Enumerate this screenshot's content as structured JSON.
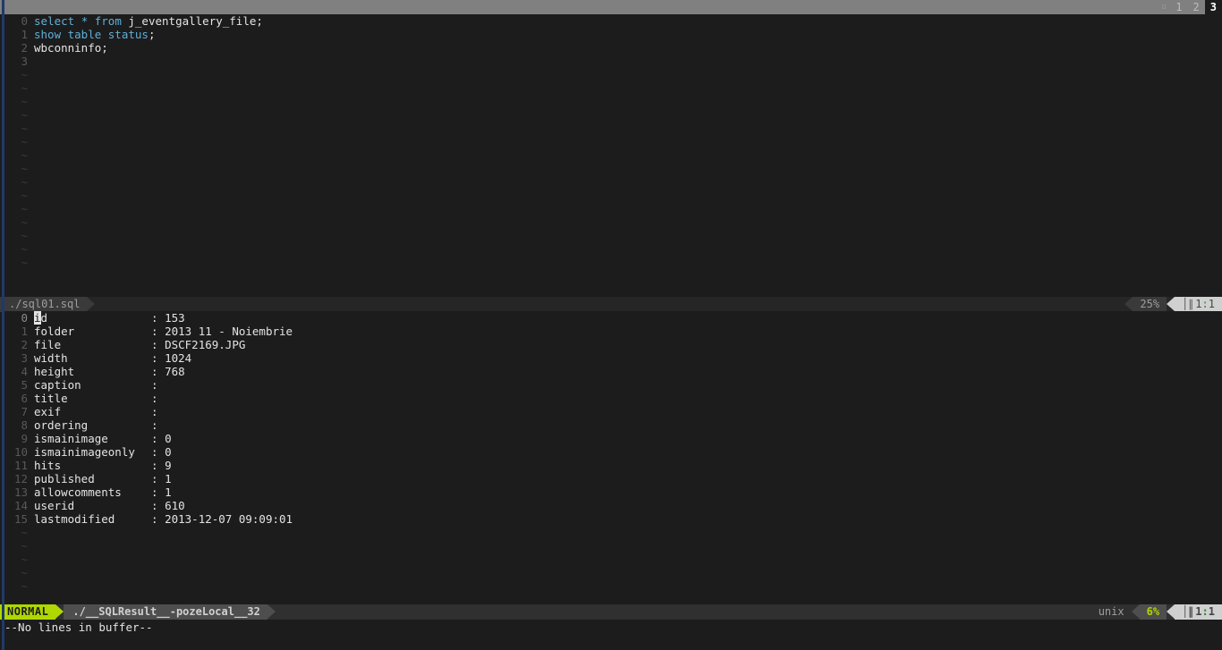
{
  "tabline": {
    "buffer_icon": "▫",
    "tabs": [
      {
        "label": "1",
        "active": false
      },
      {
        "label": "2",
        "active": false
      },
      {
        "label": "3",
        "active": true
      }
    ]
  },
  "editor_pane": {
    "lines": [
      {
        "num": "0",
        "tokens": [
          {
            "text": "select",
            "kind": "kw"
          },
          {
            "text": " ",
            "kind": "txt"
          },
          {
            "text": "*",
            "kind": "kw"
          },
          {
            "text": " ",
            "kind": "txt"
          },
          {
            "text": "from",
            "kind": "kw"
          },
          {
            "text": " j_eventgallery_file;",
            "kind": "txt"
          }
        ]
      },
      {
        "num": "1",
        "tokens": [
          {
            "text": "show table status",
            "kind": "kw"
          },
          {
            "text": ";",
            "kind": "txt"
          }
        ]
      },
      {
        "num": "2",
        "tokens": [
          {
            "text": "wbconninfo;",
            "kind": "txt"
          }
        ]
      },
      {
        "num": "3",
        "tokens": []
      }
    ],
    "tilde": "~",
    "tilde_count": 15
  },
  "status_top": {
    "filename": "./sql01.sql",
    "percent": "25%",
    "column_icon": "│∥",
    "position": "1:1",
    "position_line": "1",
    "position_col": "1"
  },
  "result_pane": {
    "rows": [
      {
        "num": "0",
        "key": "id",
        "sep": ":",
        "value": "153"
      },
      {
        "num": "1",
        "key": "folder",
        "sep": ":",
        "value": "2013 11 - Noiembrie"
      },
      {
        "num": "2",
        "key": "file",
        "sep": ":",
        "value": "DSCF2169.JPG"
      },
      {
        "num": "3",
        "key": "width",
        "sep": ":",
        "value": "1024"
      },
      {
        "num": "4",
        "key": "height",
        "sep": ":",
        "value": "768"
      },
      {
        "num": "5",
        "key": "caption",
        "sep": ":",
        "value": ""
      },
      {
        "num": "6",
        "key": "title",
        "sep": ":",
        "value": ""
      },
      {
        "num": "7",
        "key": "exif",
        "sep": ":",
        "value": ""
      },
      {
        "num": "8",
        "key": "ordering",
        "sep": ":",
        "value": ""
      },
      {
        "num": "9",
        "key": "ismainimage",
        "sep": ":",
        "value": "0"
      },
      {
        "num": "10",
        "key": "ismainimageonly",
        "sep": ":",
        "value": "0"
      },
      {
        "num": "11",
        "key": "hits",
        "sep": ":",
        "value": "9"
      },
      {
        "num": "12",
        "key": "published",
        "sep": ":",
        "value": "1"
      },
      {
        "num": "13",
        "key": "allowcomments",
        "sep": ":",
        "value": "1"
      },
      {
        "num": "14",
        "key": "userid",
        "sep": ":",
        "value": "610"
      },
      {
        "num": "15",
        "key": "lastmodified",
        "sep": ":",
        "value": "2013-12-07 09:09:01"
      }
    ],
    "cursor_char": "i",
    "cursor_row": 0,
    "tilde": "~",
    "tilde_count": 5
  },
  "status_bottom": {
    "mode": "NORMAL",
    "filename": "./__SQLResult__-pozeLocal__32",
    "fileformat": "unix",
    "percent": "6%",
    "column_icon": "│∥",
    "position": "1:1",
    "position_line": "1",
    "position_col": "1"
  },
  "cmdline": {
    "message": "--No lines in buffer--"
  },
  "colors": {
    "background": "#1c1c1c",
    "tabline_bg": "#808080",
    "keyword": "#5fafd7",
    "foreground": "#e4e4e4",
    "mode_accent": "#afd700",
    "linenumber": "#585858",
    "window_edge": "#1f3a68"
  }
}
